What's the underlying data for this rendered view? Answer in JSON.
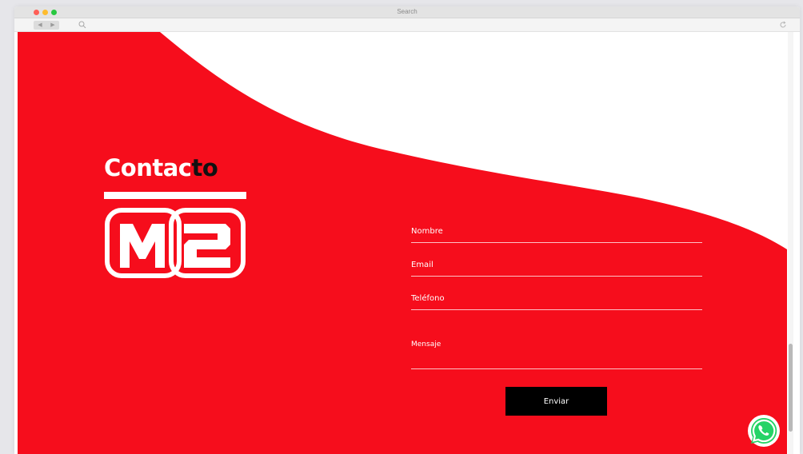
{
  "window": {
    "title": "Search"
  },
  "page": {
    "heading_part_a": "Contac",
    "heading_part_b": "to",
    "logo_text": "M2"
  },
  "form": {
    "fields": [
      {
        "label": "Nombre"
      },
      {
        "label": "Email"
      },
      {
        "label": "Teléfono"
      },
      {
        "label": "Mensaje"
      }
    ],
    "submit_label": "Enviar"
  },
  "colors": {
    "brand_red": "#f60d1c",
    "heading_dark": "#111111",
    "button_bg": "#000000",
    "whatsapp_green": "#25d366"
  },
  "icons": {
    "search": "search-icon",
    "reload": "reload-icon",
    "whatsapp": "whatsapp-icon"
  }
}
